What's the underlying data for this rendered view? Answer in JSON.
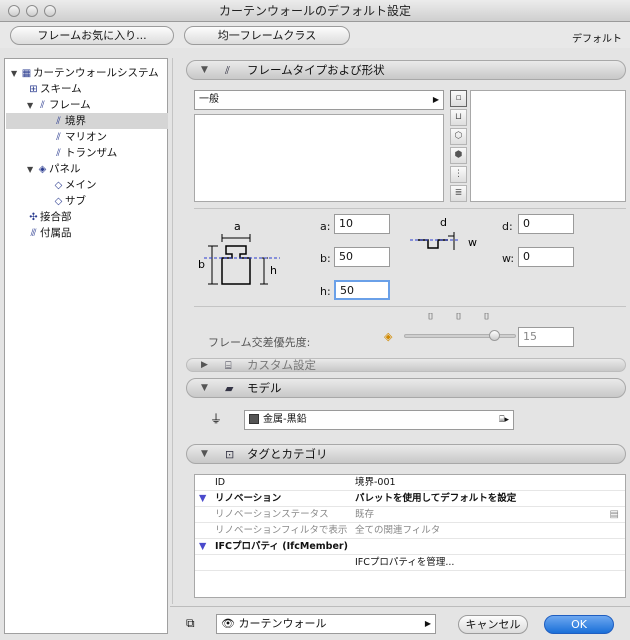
{
  "window": {
    "title": "カーテンウォールのデフォルト設定"
  },
  "toolbar": {
    "favorites_label": "フレームお気に入り...",
    "uniform_label": "均一フレームクラス",
    "default_label": "デフォルト"
  },
  "tree": {
    "items": [
      {
        "label": "カーテンウォールシステム",
        "icon": "curtain-wall-icon"
      },
      {
        "label": "スキーム",
        "icon": "scheme-icon"
      },
      {
        "label": "フレーム",
        "icon": "frame-icon"
      },
      {
        "label": "境界",
        "icon": "boundary-frame-icon"
      },
      {
        "label": "マリオン",
        "icon": "mullion-icon"
      },
      {
        "label": "トランザム",
        "icon": "transom-icon"
      },
      {
        "label": "パネル",
        "icon": "panel-icon"
      },
      {
        "label": "メイン",
        "icon": "main-panel-icon"
      },
      {
        "label": "サブ",
        "icon": "sub-panel-icon"
      },
      {
        "label": "接合部",
        "icon": "junction-icon"
      },
      {
        "label": "付属品",
        "icon": "accessory-icon"
      }
    ]
  },
  "frame_type": {
    "section_title": "フレームタイプおよび形状",
    "type_value": "一般",
    "a_label": "a:",
    "a_value": "10",
    "b_label": "b:",
    "b_value": "50",
    "h_label": "h:",
    "h_value": "50",
    "d_label": "d:",
    "d_value": "0",
    "w_label": "w:",
    "w_value": "0",
    "diagram_labels": {
      "a": "a",
      "b": "b",
      "h": "h",
      "d": "d",
      "w": "w"
    },
    "priority_label": "フレーム交差優先度:",
    "priority_value": "15",
    "priority_fraction": 0.85
  },
  "custom": {
    "section_title": "カスタム設定"
  },
  "model": {
    "section_title": "モデル",
    "material_value": "金属-黒鉛",
    "material_color": "#555555"
  },
  "tags": {
    "section_title": "タグとカテゴリ",
    "rows": [
      {
        "key": "ID",
        "value": "境界-001"
      },
      {
        "key": "リノベーション",
        "value": "パレットを使用してデフォルトを設定"
      },
      {
        "key": "リノベーションステータス",
        "value": "既存"
      },
      {
        "key": "リノベーションフィルタで表示",
        "value": "全ての関連フィルタ"
      },
      {
        "key": "IFCプロパティ (IfcMember)",
        "value": ""
      },
      {
        "key": "",
        "value": "IFCプロパティを管理..."
      }
    ]
  },
  "bottom": {
    "layer_value": "カーテンウォール",
    "cancel_label": "キャンセル",
    "ok_label": "OK"
  },
  "colors": {
    "accent": "#1a6fd8"
  }
}
